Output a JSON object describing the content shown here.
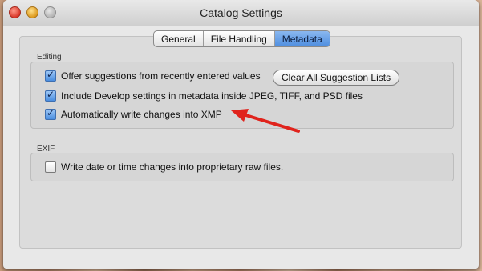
{
  "window": {
    "title": "Catalog Settings"
  },
  "tabs": [
    {
      "label": "General",
      "active": false
    },
    {
      "label": "File Handling",
      "active": false
    },
    {
      "label": "Metadata",
      "active": true
    }
  ],
  "editing": {
    "label": "Editing",
    "options": [
      {
        "label": "Offer suggestions from recently entered values",
        "checked": true
      },
      {
        "label": "Include Develop settings in metadata inside JPEG, TIFF, and PSD files",
        "checked": true
      },
      {
        "label": "Automatically write changes into XMP",
        "checked": true
      }
    ],
    "clear_button_label": "Clear All Suggestion Lists"
  },
  "exif": {
    "label": "EXIF",
    "options": [
      {
        "label": "Write date or time changes into proprietary raw files.",
        "checked": false
      }
    ]
  },
  "annotation": {
    "color": "#e0231c"
  }
}
